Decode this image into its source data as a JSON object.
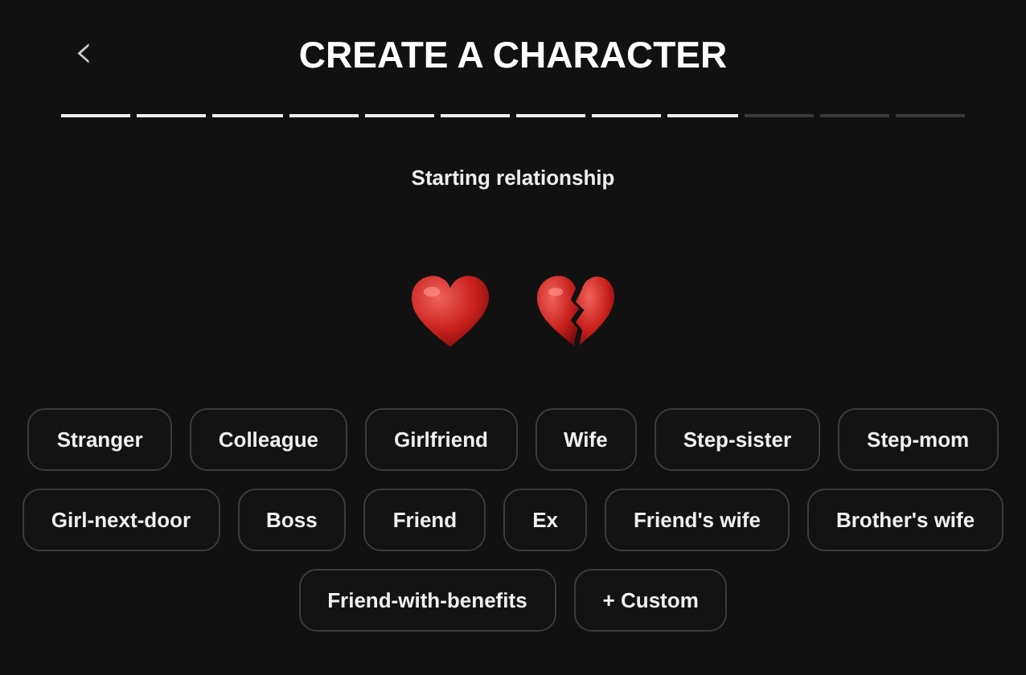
{
  "header": {
    "back_icon": "‹",
    "title": "CREATE A CHARACTER"
  },
  "progress": [
    {
      "done": true
    },
    {
      "done": true
    },
    {
      "done": true
    },
    {
      "done": true
    },
    {
      "done": true
    },
    {
      "done": true
    },
    {
      "done": true
    },
    {
      "done": true
    },
    {
      "done": true
    },
    {
      "done": false
    },
    {
      "done": false
    },
    {
      "done": false
    }
  ],
  "subtitle": "Starting relationship",
  "relationship_rows": [
    [
      "Stranger",
      "Colleague",
      "Girlfriend",
      "Wife",
      "Step-sister",
      "Step-mom"
    ],
    [
      "Girl-next-door",
      "Boss",
      "Friend",
      "Ex",
      "Friend's wife",
      "Brother's wife"
    ],
    [
      "Friend-with-benefits",
      "+ Custom"
    ]
  ]
}
